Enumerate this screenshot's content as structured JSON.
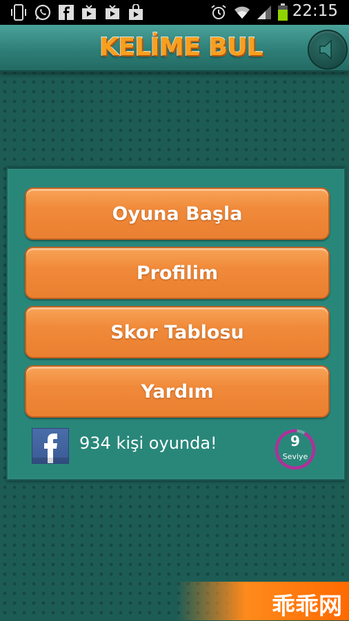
{
  "status_bar": {
    "time": "22:15",
    "icons": [
      "phone-icon",
      "whatsapp-icon",
      "facebook-icon",
      "youtube-icon",
      "youtube-icon",
      "store-icon",
      "alarm-icon",
      "wifi-icon",
      "signal-icon",
      "battery-icon"
    ]
  },
  "header": {
    "logo_text": "KELİME BUL",
    "sound_icon": "speaker-icon"
  },
  "menu": {
    "buttons": [
      {
        "label": "Oyuna Başla"
      },
      {
        "label": "Profilim"
      },
      {
        "label": "Skor Tablosu"
      },
      {
        "label": "Yardım"
      }
    ]
  },
  "footer": {
    "facebook_icon": "facebook-icon",
    "players_text": "934 kişi oyunda!",
    "level": {
      "value": "9",
      "label": "Seviye",
      "progress": 0.93
    }
  },
  "watermark": {
    "text": "乖乖网"
  },
  "colors": {
    "background": "#1d5c55",
    "header": "#2e7f77",
    "panel": "#29877a",
    "button": "#f08a3a",
    "level_ring": "#b0309a"
  }
}
